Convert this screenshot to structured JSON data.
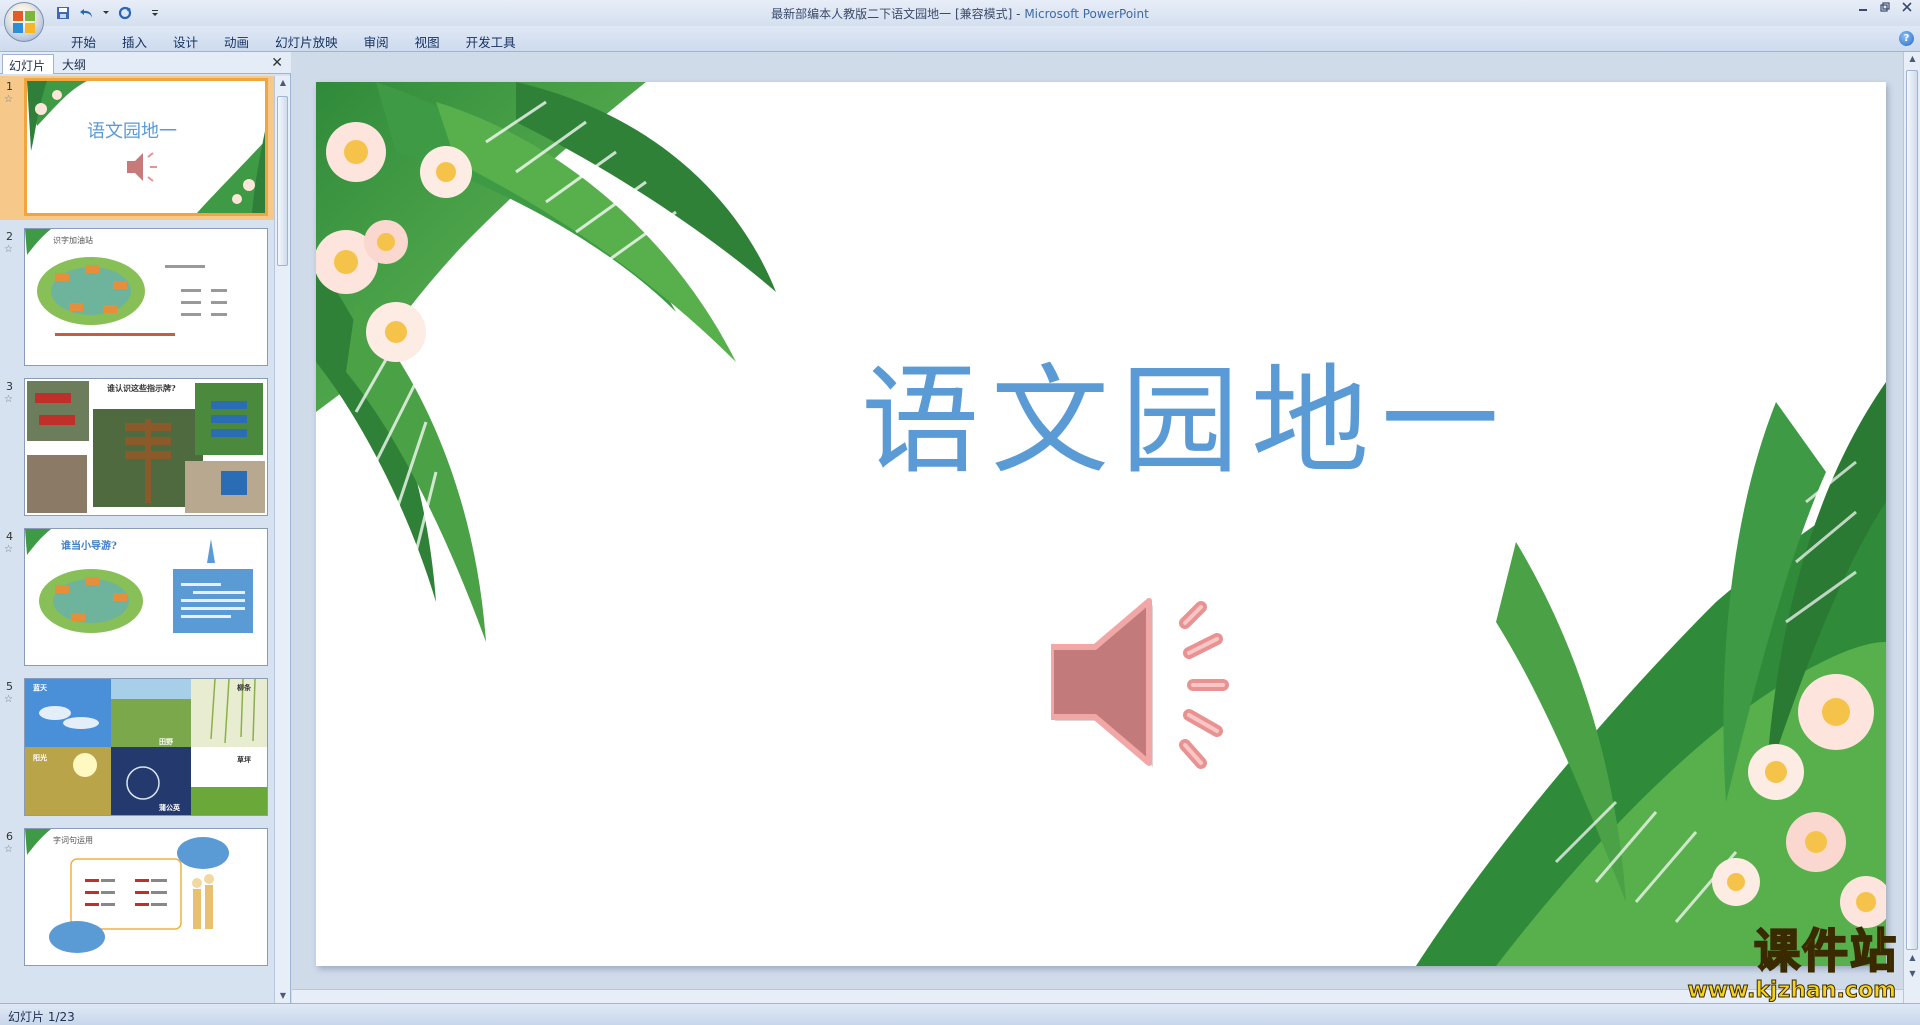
{
  "window": {
    "title_doc": "最新部编本人教版二下语文园地一 [兼容模式] - ",
    "title_app": "Microsoft PowerPoint"
  },
  "ribbon": {
    "tabs": [
      "开始",
      "插入",
      "设计",
      "动画",
      "幻灯片放映",
      "审阅",
      "视图",
      "开发工具"
    ]
  },
  "pane": {
    "tab_slides": "幻灯片",
    "tab_outline": "大纲",
    "close": "✕"
  },
  "thumbnails": [
    {
      "num": "1",
      "title": "语文园地一"
    },
    {
      "num": "2",
      "title": "识字加油站"
    },
    {
      "num": "3",
      "title": "谁认识这些指示牌?"
    },
    {
      "num": "4",
      "title": "谁当小导游?"
    },
    {
      "num": "5",
      "title": ""
    },
    {
      "num": "6",
      "title": "字词句运用"
    }
  ],
  "thumb5_labels": [
    "蓝天",
    "田野",
    "柳条",
    "阳光",
    "蒲公英",
    "草坪"
  ],
  "slide": {
    "title": "语文园地一"
  },
  "status": {
    "slide_info": "幻灯片 1/23"
  },
  "watermark": {
    "text": "课件站",
    "url": "www.kjzhan.com"
  },
  "colors": {
    "title_blue": "#5b9bd5",
    "selection": "#f0a53f",
    "speaker": "#e99292"
  }
}
